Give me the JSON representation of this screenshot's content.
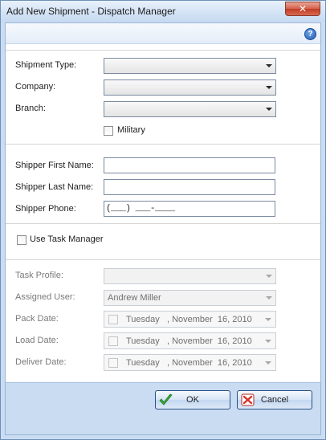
{
  "window": {
    "title": "Add New Shipment - Dispatch Manager",
    "close_glyph": "✕"
  },
  "help": {
    "glyph": "?"
  },
  "shipment": {
    "type_label": "Shipment Type:",
    "type_value": "",
    "company_label": "Company:",
    "company_value": "",
    "branch_label": "Branch:",
    "branch_value": "",
    "military_label": "Military",
    "military_checked": false
  },
  "shipper": {
    "first_name_label": "Shipper First Name:",
    "first_name_value": "",
    "last_name_label": "Shipper Last Name:",
    "last_name_value": "",
    "phone_label": "Shipper Phone:",
    "phone_value": "(___) ___-____"
  },
  "task": {
    "use_task_manager_label": "Use Task Manager",
    "use_task_manager_checked": false,
    "profile_label": "Task Profile:",
    "profile_value": "",
    "assigned_user_label": "Assigned User:",
    "assigned_user_value": "Andrew Miller",
    "pack_date_label": "Pack Date:",
    "pack_date_value": "Tuesday   , November  16, 2010",
    "load_date_label": "Load Date:",
    "load_date_value": "Tuesday   , November  16, 2010",
    "deliver_date_label": "Deliver Date:",
    "deliver_date_value": "Tuesday   , November  16, 2010"
  },
  "buttons": {
    "ok_label": "OK",
    "cancel_label": "Cancel"
  },
  "icons": {
    "ok": "checkmark-icon",
    "cancel": "x-icon",
    "help": "help-icon",
    "close": "close-icon",
    "ok_color": "#3aa83a",
    "cancel_color": "#d8332a"
  }
}
